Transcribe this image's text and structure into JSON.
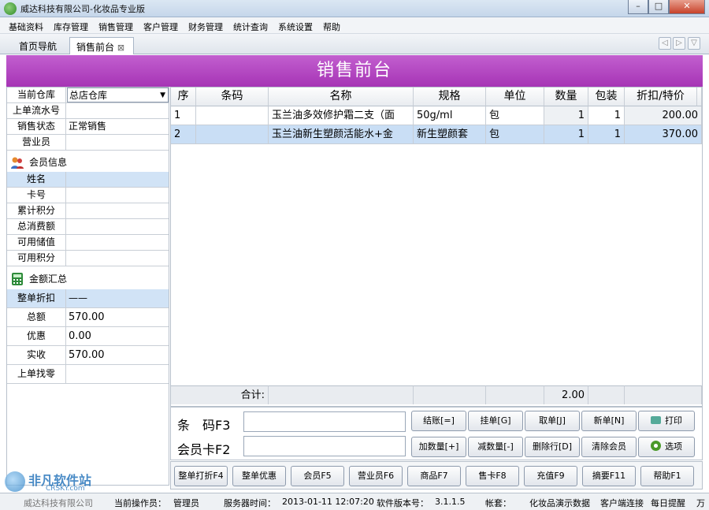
{
  "window": {
    "title": "威达科技有限公司-化妆品专业版",
    "min": "–",
    "max": "□",
    "close": "✕"
  },
  "menu": [
    "基础资料",
    "库存管理",
    "销售管理",
    "客户管理",
    "财务管理",
    "统计查询",
    "系统设置",
    "帮助"
  ],
  "tabs": {
    "home": "首页导航",
    "active": "销售前台",
    "close": "⊠"
  },
  "nav": {
    "back": "◁",
    "forward": "▷",
    "down": "▽"
  },
  "banner": "销售前台",
  "left": {
    "warehouse_label": "当前仓库",
    "warehouse_value": "总店仓库",
    "last_serial_label": "上单流水号",
    "last_serial_value": "",
    "status_label": "销售状态",
    "status_value": "正常销售",
    "clerk_label": "营业员",
    "clerk_value": "",
    "member_header": "会员信息",
    "member_rows": [
      {
        "label": "姓名",
        "value": ""
      },
      {
        "label": "卡号",
        "value": ""
      },
      {
        "label": "累计积分",
        "value": ""
      },
      {
        "label": "总消费额",
        "value": ""
      },
      {
        "label": "可用储值",
        "value": ""
      },
      {
        "label": "可用积分",
        "value": ""
      }
    ],
    "amount_header": "金额汇总",
    "amount_rows": [
      {
        "label": "整单折扣",
        "value": "——"
      },
      {
        "label": "总额",
        "value": "570.00"
      },
      {
        "label": "优惠",
        "value": "0.00"
      },
      {
        "label": "实收",
        "value": "570.00"
      },
      {
        "label": "上单找零",
        "value": ""
      }
    ]
  },
  "grid": {
    "columns": [
      "序",
      "条码",
      "名称",
      "规格",
      "单位",
      "数量",
      "包装",
      "折扣/特价"
    ],
    "rows": [
      [
        "1",
        "",
        "玉兰油多效修护霜二支（面",
        "50g/ml",
        "包",
        "1",
        "1",
        "200.00"
      ],
      [
        "2",
        "",
        "玉兰油新生塑颜活能水+金",
        "新生塑颜套",
        "包",
        "1",
        "1",
        "370.00"
      ]
    ],
    "total_label": "合计:",
    "total_qty": "2.00"
  },
  "entry": {
    "barcode_label": "条　码F3",
    "member_label": "会员卡F2"
  },
  "buttons1": [
    "结账[=]",
    "挂单[G]",
    "取单[J]",
    "新单[N]",
    "打印"
  ],
  "buttons2": [
    "加数量[+]",
    "减数量[-]",
    "删除行[D]",
    "清除会员",
    "选项"
  ],
  "fn_buttons": [
    "整单打折F4",
    "整单优惠",
    "会员F5",
    "营业员F6",
    "商品F7",
    "售卡F8",
    "充值F9",
    "摘要F11",
    "帮助F1"
  ],
  "status": {
    "company": "威达科技有限公司",
    "operator_label": "当前操作员：",
    "operator": "管理员",
    "server_time_label": "服务器时间：",
    "server_time": "2013-01-11 12:07:20",
    "version_label": "软件版本号：",
    "version": "3.1.1.5",
    "set_label": "帐套：",
    "set": "化妆品演示数据",
    "client": "客户端连接",
    "reminder": "每日提醒",
    "extra": "万"
  },
  "watermark": {
    "text": "非凡软件站",
    "sub": "CRSKY.com"
  }
}
